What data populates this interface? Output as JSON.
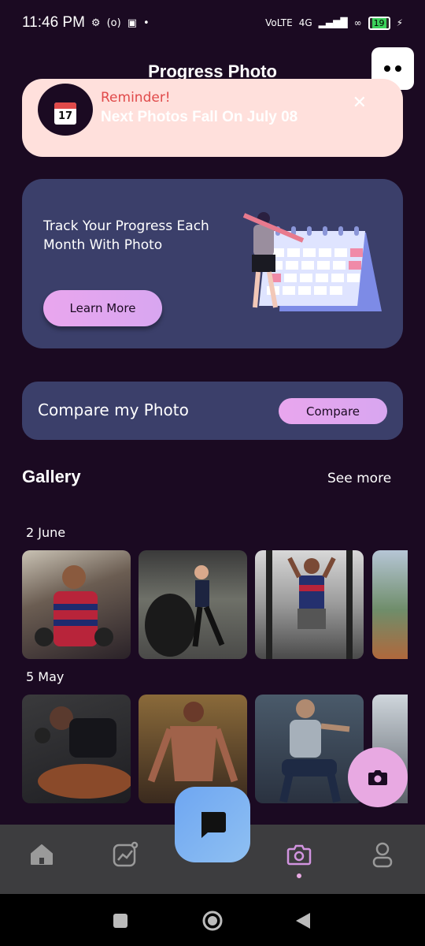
{
  "status_bar": {
    "time": "11:46 PM",
    "network": "4G",
    "battery": "19"
  },
  "header": {
    "title": "Progress Photo",
    "menu_icon": "more-dots-icon"
  },
  "reminder": {
    "label": "Reminder!",
    "text": "Next Photos Fall On July 08",
    "calendar_day": "17",
    "close_icon": "close-icon"
  },
  "promo": {
    "text": "Track Your Progress Each Month With Photo",
    "button_label": "Learn More"
  },
  "compare": {
    "label": "Compare my Photo",
    "button_label": "Compare"
  },
  "gallery": {
    "title": "Gallery",
    "see_more": "See more",
    "groups": [
      {
        "date": "2 June",
        "photos": [
          "gym-photo-1",
          "gym-photo-2",
          "gym-photo-3",
          "gym-photo-4"
        ]
      },
      {
        "date": "5 May",
        "photos": [
          "gym-photo-5",
          "gym-photo-6",
          "gym-photo-7",
          "gym-photo-8"
        ]
      }
    ]
  },
  "bottom_nav": {
    "items": [
      "home-icon",
      "analytics-icon",
      "camera-icon",
      "profile-icon"
    ],
    "active": "camera-icon",
    "center_action": "chat-icon"
  },
  "colors": {
    "background": "#1b0a22",
    "card": "#3b3f6a",
    "accent_pink": "#e8a9e2",
    "reminder_bg": "#ffe0dc",
    "reminder_label": "#e04a4a"
  }
}
